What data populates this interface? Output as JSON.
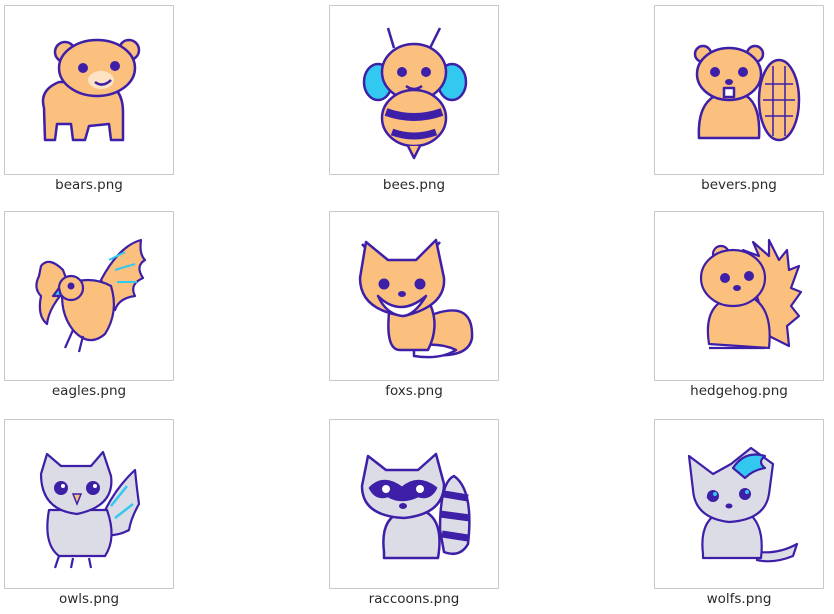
{
  "files": [
    {
      "name": "bears.png",
      "icon": "bear-icon"
    },
    {
      "name": "bees.png",
      "icon": "bee-icon"
    },
    {
      "name": "bevers.png",
      "icon": "beaver-icon"
    },
    {
      "name": "eagles.png",
      "icon": "eagle-icon"
    },
    {
      "name": "foxs.png",
      "icon": "fox-icon"
    },
    {
      "name": "hedgehog.png",
      "icon": "hedgehog-icon"
    },
    {
      "name": "owls.png",
      "icon": "owl-icon"
    },
    {
      "name": "raccoons.png",
      "icon": "raccoon-icon"
    },
    {
      "name": "wolfs.png",
      "icon": "wolf-icon"
    }
  ],
  "colors": {
    "outline": "#3d1fa8",
    "orange": "#fbbf7e",
    "blue": "#33c8f0",
    "gray": "#dcdce6"
  }
}
